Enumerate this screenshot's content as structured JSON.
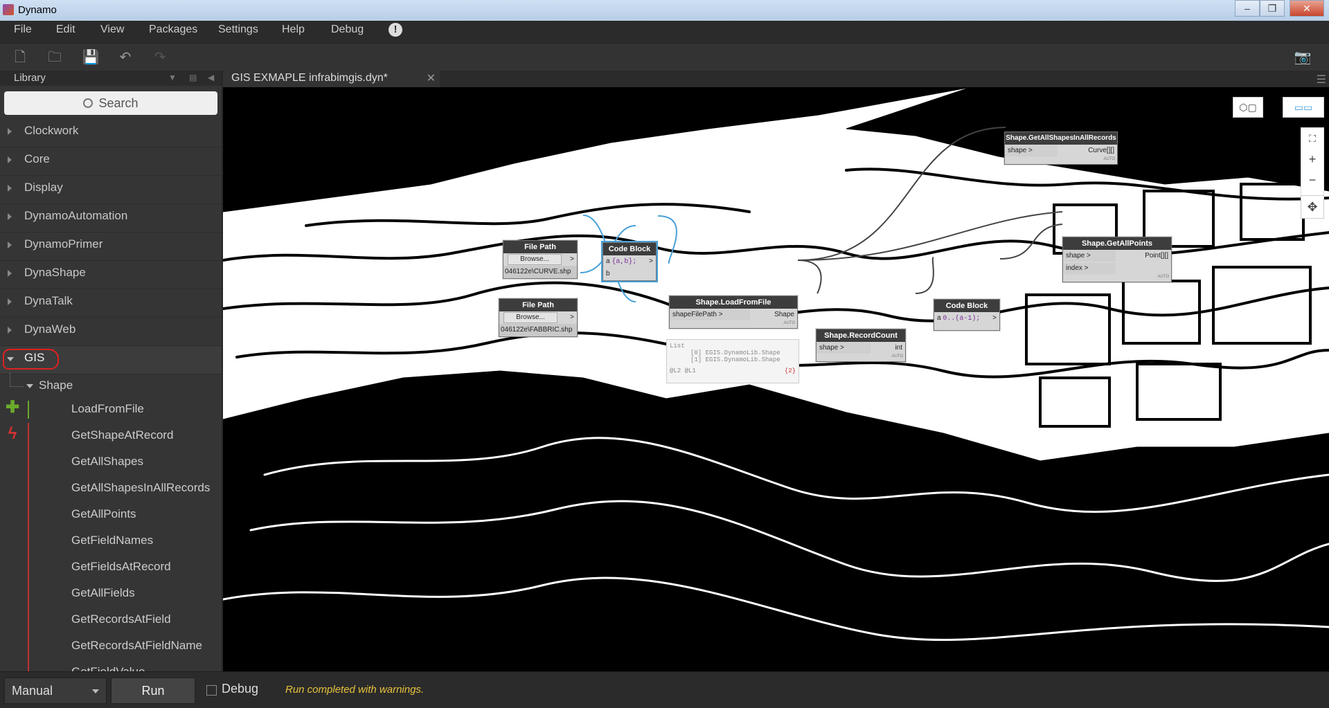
{
  "window": {
    "title": "Dynamo"
  },
  "menu": {
    "items": [
      "File",
      "Edit",
      "View",
      "Packages",
      "Settings",
      "Help",
      "Debug"
    ]
  },
  "library": {
    "title": "Library",
    "search_placeholder": "Search",
    "categories": [
      "Clockwork",
      "Core",
      "Display",
      "DynamoAutomation",
      "DynamoPrimer",
      "DynaShape",
      "DynaTalk",
      "DynaWeb"
    ],
    "open_category": "GIS",
    "subcategory": "Shape",
    "create_items": [
      "LoadFromFile"
    ],
    "action_items": [
      "GetShapeAtRecord",
      "GetAllShapes",
      "GetAllShapesInAllRecords",
      "GetAllPoints",
      "GetFieldNames",
      "GetFieldsAtRecord",
      "GetAllFields",
      "GetRecordsAtField",
      "GetRecordsAtFieldName",
      "GetFieldValue"
    ]
  },
  "tab": {
    "label": "GIS EXMAPLE infrabimgis.dyn*"
  },
  "nodes": {
    "filepath1": {
      "title": "File Path",
      "button": "Browse...",
      "out": ">",
      "value": "046122e\\CURVE.shp"
    },
    "filepath2": {
      "title": "File Path",
      "button": "Browse...",
      "out": ">",
      "value": "046122e\\FABBRIC.shp"
    },
    "codeblock1": {
      "title": "Code Block",
      "in_a": "a",
      "in_b": "b",
      "code": "{a,b};",
      "out": ">"
    },
    "loadfromfile": {
      "title": "Shape.LoadFromFile",
      "in": "shapeFilePath",
      "out": "Shape",
      "auto": "AUTO"
    },
    "recordcount": {
      "title": "Shape.RecordCount",
      "in": "shape",
      "out": "int",
      "auto": "AUTO"
    },
    "codeblock2": {
      "title": "Code Block",
      "in_a": "a",
      "code": "0..(a-1);",
      "out": ">"
    },
    "getallshapes": {
      "title": "Shape.GetAllShapesInAllRecords",
      "in": "shape",
      "out": "Curve[][]",
      "auto": "AUTO"
    },
    "getallpoints": {
      "title": "Shape.GetAllPoints",
      "in1": "shape",
      "in2": "index",
      "out": "Point[][]",
      "auto": "AUTO"
    }
  },
  "preview": {
    "line1": "List",
    "line2": "[0] EGIS.DynamoLib.Shape",
    "line3": "[1] EGIS.DynamoLib.Shape",
    "footer_left": "@L2 @L1",
    "footer_right": "{2}"
  },
  "bottom": {
    "run_mode": "Manual",
    "run_label": "Run",
    "debug_label": "Debug",
    "status": "Run completed with warnings."
  },
  "icons": {
    "warning": "!"
  }
}
